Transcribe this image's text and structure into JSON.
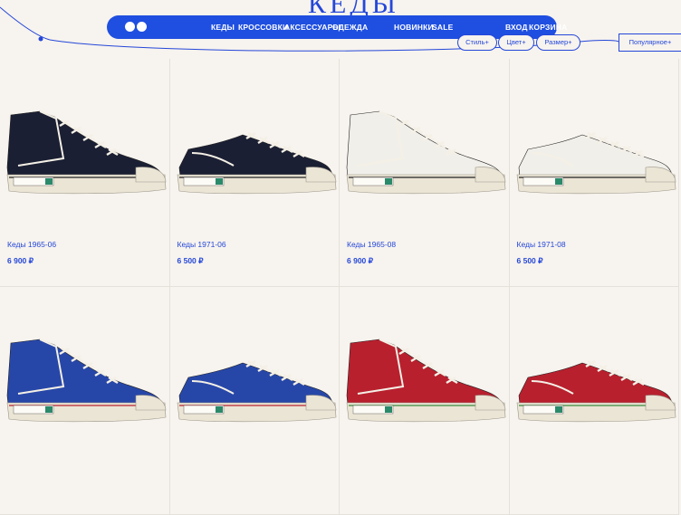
{
  "page_title": "КЕДЫ",
  "nav": {
    "items": [
      "КЕДЫ",
      "КРОССОВКИ",
      "АКСЕССУАРЫ",
      "ОДЕЖДА"
    ],
    "extra": [
      "НОВИНКИ",
      "SALE"
    ],
    "right": [
      "ВХОД",
      "КОРЗИНА"
    ]
  },
  "filters": [
    "Стиль+",
    "Цвет+",
    "Размер+"
  ],
  "sort_label": "Популярное+",
  "brand_label": "Два Мяча",
  "products": [
    {
      "name": "Кеды 1965-06",
      "price": "6 900 ₽",
      "color": "#1b1f33",
      "style": "high"
    },
    {
      "name": "Кеды 1971-06",
      "price": "6 500 ₽",
      "color": "#1b1f33",
      "style": "low"
    },
    {
      "name": "Кеды 1965-08",
      "price": "6 900 ₽",
      "color": "#f1efe9",
      "style": "high"
    },
    {
      "name": "Кеды 1971-08",
      "price": "6 500 ₽",
      "color": "#f1efe9",
      "style": "low"
    },
    {
      "name": "",
      "price": "",
      "color": "#2747a8",
      "style": "high"
    },
    {
      "name": "",
      "price": "",
      "color": "#2747a8",
      "style": "low"
    },
    {
      "name": "",
      "price": "",
      "color": "#b8202e",
      "style": "high"
    },
    {
      "name": "",
      "price": "",
      "color": "#b8202e",
      "style": "low"
    }
  ],
  "colors": {
    "accent": "#1f4fe0",
    "background": "#f7f3ee"
  }
}
